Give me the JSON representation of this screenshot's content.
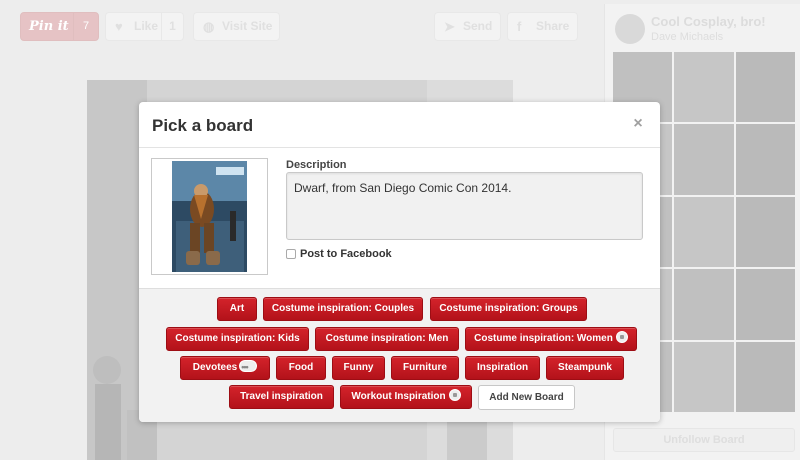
{
  "background": {
    "pinit": {
      "label": "Pin it",
      "count": "7"
    },
    "like": {
      "label": "Like",
      "count": "1"
    },
    "visit_site": {
      "label": "Visit Site"
    },
    "send": {
      "label": "Send"
    },
    "share": {
      "label": "Share"
    },
    "sidebar": {
      "board_title": "Cool Cosplay, bro!",
      "user_name": "Dave Michaels",
      "unfollow_label": "Unfollow Board"
    }
  },
  "modal": {
    "title": "Pick a board",
    "close_glyph": "×",
    "description_label": "Description",
    "description_value": "Dwarf, from San Diego Comic Con 2014.",
    "post_to_facebook_label": "Post to Facebook",
    "post_to_facebook_checked": false,
    "boards": [
      {
        "label": "Art",
        "secret": false,
        "group": false
      },
      {
        "label": "Costume inspiration: Couples",
        "secret": false,
        "group": false
      },
      {
        "label": "Costume inspiration: Groups",
        "secret": false,
        "group": false
      },
      {
        "label": "Costume inspiration: Kids",
        "secret": false,
        "group": false
      },
      {
        "label": "Costume inspiration: Men",
        "secret": false,
        "group": false
      },
      {
        "label": "Costume inspiration: Women",
        "secret": true,
        "group": false
      },
      {
        "label": "Devotees",
        "secret": false,
        "group": true
      },
      {
        "label": "Food",
        "secret": false,
        "group": false
      },
      {
        "label": "Funny",
        "secret": false,
        "group": false
      },
      {
        "label": "Furniture",
        "secret": false,
        "group": false
      },
      {
        "label": "Inspiration",
        "secret": false,
        "group": false
      },
      {
        "label": "Steampunk",
        "secret": false,
        "group": false
      },
      {
        "label": "Travel inspiration",
        "secret": false,
        "group": false
      },
      {
        "label": "Workout Inspiration",
        "secret": true,
        "group": false
      }
    ],
    "add_new_board_label": "Add New Board"
  },
  "colors": {
    "board_button": "#c41a22",
    "pinit_brand": "#cb2027"
  },
  "icons": {
    "like": "heart-icon",
    "visit_site": "globe-icon",
    "send": "paper-plane-icon",
    "share": "facebook-icon",
    "close": "close-icon",
    "secret_board": "lock-icon",
    "group_board": "group-icon"
  }
}
